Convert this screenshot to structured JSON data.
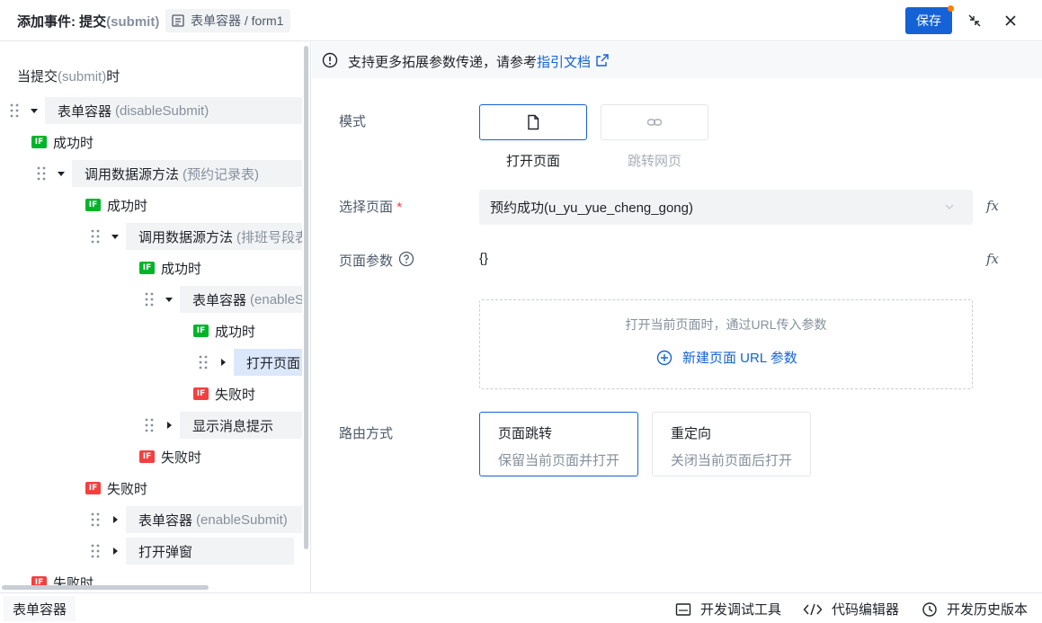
{
  "header": {
    "title_main": "添加事件: 提交",
    "title_event": "(submit)",
    "breadcrumb": "表单容器 / form1",
    "save_label": "保存"
  },
  "tree": {
    "trigger_prefix": "当提交",
    "trigger_event": "(submit)",
    "trigger_suffix": "时",
    "badge": "IF",
    "nodes": [
      {
        "label": "表单容器",
        "sub": "(disableSubmit)"
      },
      {
        "label": "调用数据源方法",
        "sub": "(预约记录表)"
      },
      {
        "label": "调用数据源方法",
        "sub": "(排班号段表"
      },
      {
        "label": "表单容器",
        "sub": "(enableS"
      },
      {
        "label": "打开页面",
        "sub": ""
      },
      {
        "label": "显示消息提示",
        "sub": ""
      },
      {
        "label": "表单容器",
        "sub": "(enableSubmit)"
      },
      {
        "label": "打开弹窗",
        "sub": ""
      }
    ],
    "branches": {
      "success": "成功时",
      "fail": "失败时",
      "fail_cut": "失败时"
    }
  },
  "notice": {
    "text": "支持更多拓展参数传递，请参考",
    "link": "指引文档"
  },
  "form": {
    "mode_label": "模式",
    "mode_options": [
      "打开页面",
      "跳转网页"
    ],
    "mode_selected": "打开页面",
    "page_label": "选择页面",
    "required_mark": "*",
    "page_value": "预约成功(u_yu_yue_cheng_gong)",
    "params_label": "页面参数",
    "params_value": "{}",
    "params_hint": "打开当前页面时，通过URL传入参数",
    "add_param": "新建页面 URL 参数",
    "fx": "fx",
    "route_label": "路由方式",
    "routes": [
      {
        "title": "页面跳转",
        "desc": "保留当前页面并打开"
      },
      {
        "title": "重定向",
        "desc": "关闭当前页面后打开"
      }
    ],
    "route_selected": "页面跳转"
  },
  "footer": {
    "tab": "表单容器",
    "debug": "开发调试工具",
    "code": "代码编辑器",
    "history": "开发历史版本"
  },
  "colors": {
    "primary": "#1562d6",
    "success_badge": "#00b42a",
    "fail_badge": "#f53f3f"
  }
}
